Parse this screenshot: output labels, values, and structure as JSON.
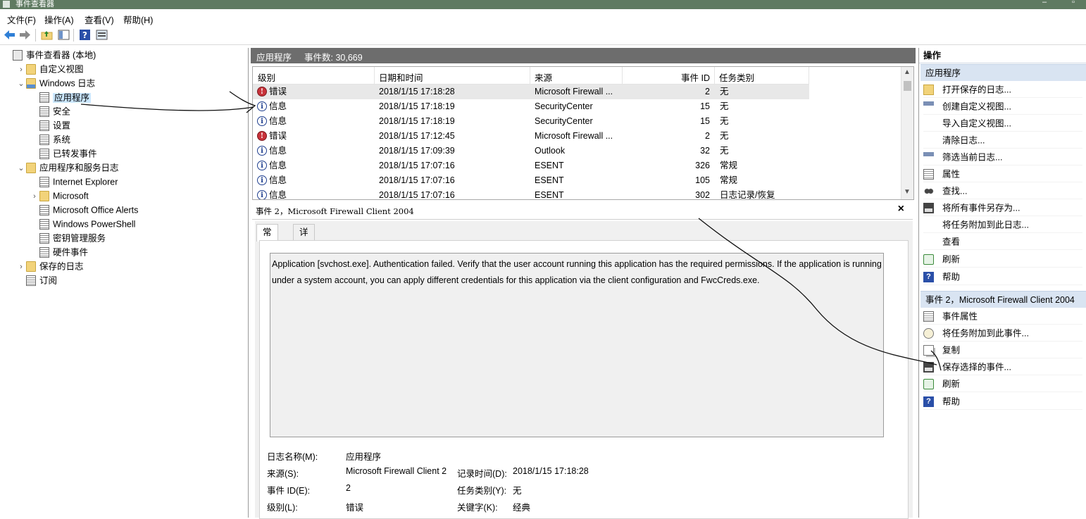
{
  "window": {
    "title": "事件查看器"
  },
  "menu": [
    "文件(F)",
    "操作(A)",
    "查看(V)",
    "帮助(H)"
  ],
  "toolbar": {
    "icons": [
      "back-arrow-icon",
      "forward-arrow-icon",
      "folder-up-icon",
      "show-hide-tree-icon",
      "help-icon",
      "show-action-pane-icon"
    ]
  },
  "tree": [
    {
      "label": "事件查看器 (本地)",
      "icon": "event-viewer-icon",
      "expander": ""
    },
    {
      "label": "自定义视图",
      "icon": "folder-icon",
      "expander": "›"
    },
    {
      "label": "Windows 日志",
      "icon": "folder-log-icon",
      "expander": "⌄"
    },
    {
      "label": "应用程序",
      "icon": "log-icon",
      "expander": "",
      "selected": true
    },
    {
      "label": "安全",
      "icon": "log-icon",
      "expander": ""
    },
    {
      "label": "设置",
      "icon": "log-icon",
      "expander": ""
    },
    {
      "label": "系统",
      "icon": "log-icon",
      "expander": ""
    },
    {
      "label": "已转发事件",
      "icon": "log-icon",
      "expander": ""
    },
    {
      "label": "应用程序和服务日志",
      "icon": "folder-icon",
      "expander": "⌄"
    },
    {
      "label": "Internet Explorer",
      "icon": "log-icon",
      "expander": ""
    },
    {
      "label": "Microsoft",
      "icon": "folder-icon",
      "expander": "›"
    },
    {
      "label": "Microsoft Office Alerts",
      "icon": "log-icon",
      "expander": ""
    },
    {
      "label": "Windows PowerShell",
      "icon": "log-icon",
      "expander": ""
    },
    {
      "label": "密钥管理服务",
      "icon": "log-icon",
      "expander": ""
    },
    {
      "label": "硬件事件",
      "icon": "log-icon",
      "expander": ""
    },
    {
      "label": "保存的日志",
      "icon": "folder-icon",
      "expander": "›"
    },
    {
      "label": "订阅",
      "icon": "subscription-icon",
      "expander": ""
    }
  ],
  "middle": {
    "log_name": "应用程序",
    "event_count": "事件数: 30,669"
  },
  "grid": {
    "columns": [
      "级别",
      "日期和时间",
      "来源",
      "事件 ID",
      "任务类别"
    ],
    "rows": [
      {
        "level": "错误",
        "type": "error",
        "datetime": "2018/1/15 17:18:28",
        "source": "Microsoft Firewall ...",
        "id": "2",
        "category": "无"
      },
      {
        "level": "信息",
        "type": "info",
        "datetime": "2018/1/15 17:18:19",
        "source": "SecurityCenter",
        "id": "15",
        "category": "无"
      },
      {
        "level": "信息",
        "type": "info",
        "datetime": "2018/1/15 17:18:19",
        "source": "SecurityCenter",
        "id": "15",
        "category": "无"
      },
      {
        "level": "错误",
        "type": "error",
        "datetime": "2018/1/15 17:12:45",
        "source": "Microsoft Firewall ...",
        "id": "2",
        "category": "无"
      },
      {
        "level": "信息",
        "type": "info",
        "datetime": "2018/1/15 17:09:39",
        "source": "Outlook",
        "id": "32",
        "category": "无"
      },
      {
        "level": "信息",
        "type": "info",
        "datetime": "2018/1/15 17:07:16",
        "source": "ESENT",
        "id": "326",
        "category": "常规"
      },
      {
        "level": "信息",
        "type": "info",
        "datetime": "2018/1/15 17:07:16",
        "source": "ESENT",
        "id": "105",
        "category": "常规"
      },
      {
        "level": "信息",
        "type": "info",
        "datetime": "2018/1/15 17:07:16",
        "source": "ESENT",
        "id": "302",
        "category": "日志记录/恢复"
      }
    ]
  },
  "detail": {
    "header": "事件 2，Microsoft Firewall Client 2004",
    "tabs": [
      "常规",
      "详细信息"
    ],
    "message": "Application [svchost.exe]. Authentication failed. Verify that the user account running this application has the required permissions. If the application is running under a system account, you can apply different credentials for this application via the client configuration and FwcCreds.exe.",
    "fields": {
      "log_name_label": "日志名称(M):",
      "log_name_value": "应用程序",
      "source_label": "来源(S):",
      "source_value": "Microsoft Firewall Client 2",
      "logged_label": "记录时间(D):",
      "logged_value": "2018/1/15 17:18:28",
      "event_id_label": "事件 ID(E):",
      "event_id_value": "2",
      "task_label": "任务类别(Y):",
      "task_value": "无",
      "level_label": "级别(L):",
      "level_value": "错误",
      "keywords_label": "关键字(K):",
      "keywords_value": "经典"
    }
  },
  "actions": {
    "title": "操作",
    "section1": "应用程序",
    "items1": [
      {
        "label": "打开保存的日志...",
        "icon": "open-folder-icon"
      },
      {
        "label": "创建自定义视图...",
        "icon": "filter-create-icon"
      },
      {
        "label": "导入自定义视图...",
        "icon": ""
      },
      {
        "label": "清除日志...",
        "icon": ""
      },
      {
        "label": "筛选当前日志...",
        "icon": "filter-icon"
      },
      {
        "label": "属性",
        "icon": "properties-icon"
      },
      {
        "label": "查找...",
        "icon": "binoculars-icon"
      },
      {
        "label": "将所有事件另存为...",
        "icon": "save-icon"
      },
      {
        "label": "将任务附加到此日志...",
        "icon": ""
      },
      {
        "label": "查看",
        "icon": ""
      },
      {
        "label": "刷新",
        "icon": "refresh-icon"
      },
      {
        "label": "帮助",
        "icon": "help-icon"
      }
    ],
    "section2": "事件 2，Microsoft Firewall Client 2004",
    "items2": [
      {
        "label": "事件属性",
        "icon": "properties-icon"
      },
      {
        "label": "将任务附加到此事件...",
        "icon": "task-icon"
      },
      {
        "label": "复制",
        "icon": "copy-icon"
      },
      {
        "label": "保存选择的事件...",
        "icon": "save-icon"
      },
      {
        "label": "刷新",
        "icon": "refresh-icon"
      },
      {
        "label": "帮助",
        "icon": "help-icon"
      }
    ]
  },
  "help_glyph": "?",
  "close_glyph": "×"
}
